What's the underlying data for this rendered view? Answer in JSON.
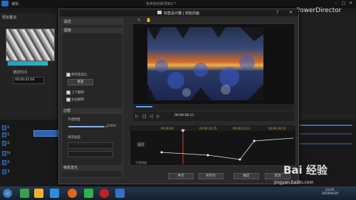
{
  "app": {
    "menu": [
      "编辑"
    ],
    "title": "未命名的新项目2 *",
    "brand": "PowerDirector",
    "left_tab": "预览叠加",
    "duration_label": "播放时间",
    "duration_value": "00:00:02:00"
  },
  "dialog": {
    "title": "标签设计器 | 初始页面",
    "help": "?",
    "close": "✕",
    "props_header": "属性",
    "section_image": "图像",
    "cb_keep_ratio": "保持宽高比",
    "reset_button": "重置",
    "cb_flip_v": "上下翻转",
    "cb_flip_h": "左右翻转",
    "section_border": "边框",
    "opacity_label": "不透明度",
    "opacity_value": "100%",
    "fill_label": "填充类型",
    "section_shadow": "阴影",
    "section_more": "物体发光",
    "timecode": "00:00:06:11",
    "keyframe_label": "图层",
    "keyframe_label2": "不透明度",
    "ruler": [
      "00:00:00",
      "00:00:10:25",
      "00:00:23:13",
      "00:00:36:10"
    ],
    "btn_share": "共享",
    "btn_save_as": "另存为",
    "btn_ok": "确定",
    "btn_cancel": "取消"
  },
  "taskbar": {
    "clock_time": "22:01",
    "clock_date": "2019/4/20"
  },
  "watermark": {
    "text": "Bai 经验",
    "url": "jingyan.baidu.com"
  }
}
